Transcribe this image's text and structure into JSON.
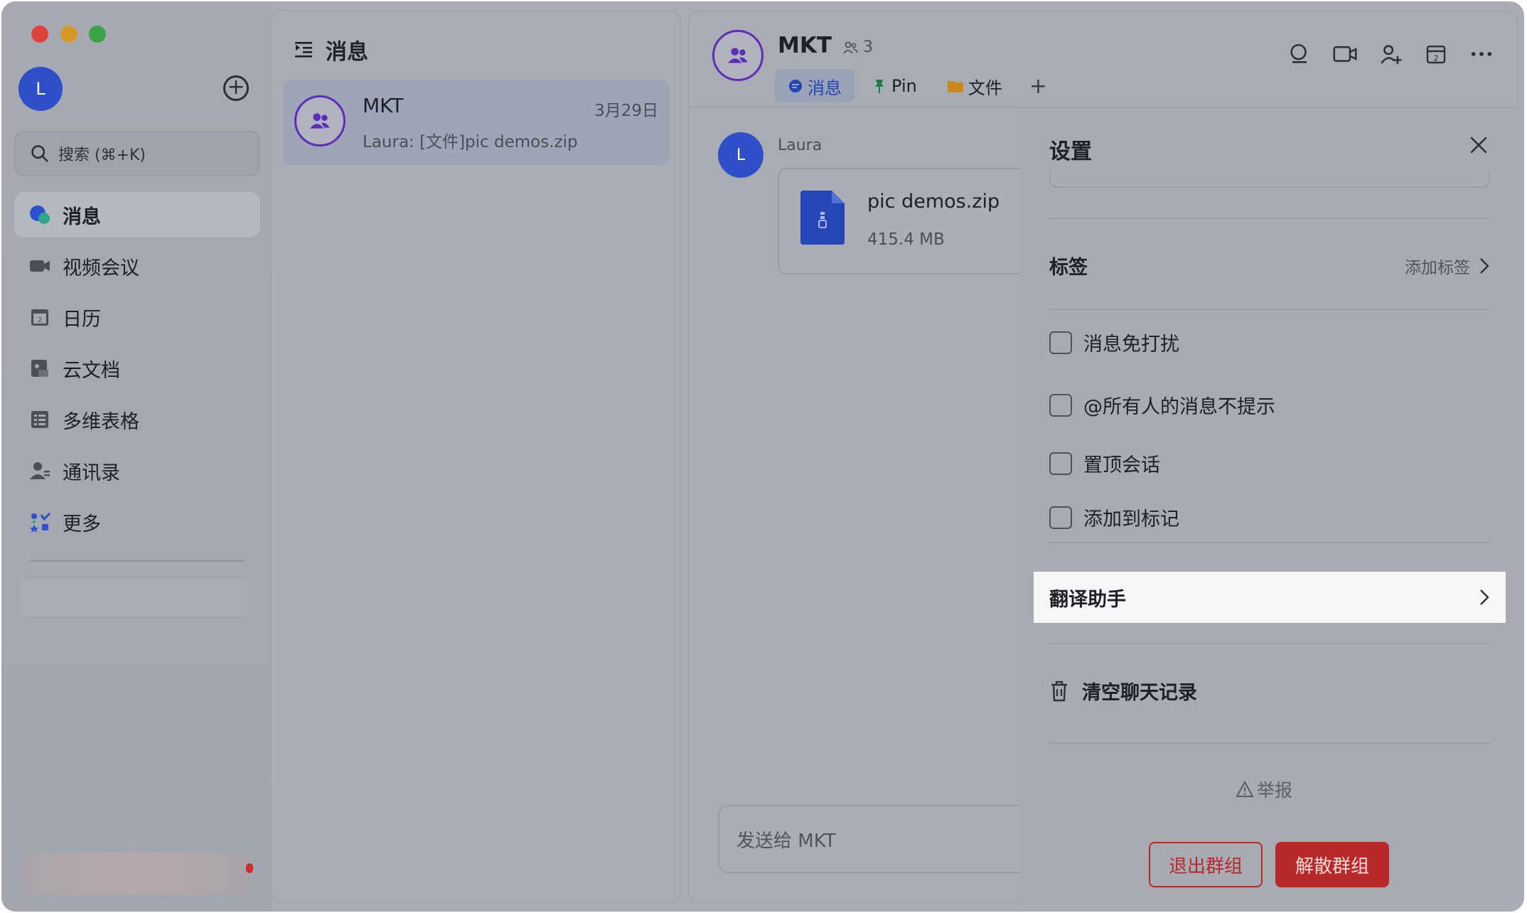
{
  "self_avatar_letter": "L",
  "search": {
    "placeholder": "搜索 (⌘+K)"
  },
  "nav": {
    "items": [
      {
        "label": "消息",
        "icon": "chat-bubble-icon",
        "active": true
      },
      {
        "label": "视频会议",
        "icon": "video-camera-icon"
      },
      {
        "label": "日历",
        "icon": "calendar-icon"
      },
      {
        "label": "云文档",
        "icon": "cloud-doc-icon"
      },
      {
        "label": "多维表格",
        "icon": "table-icon"
      },
      {
        "label": "通讯录",
        "icon": "contacts-icon"
      },
      {
        "label": "更多",
        "icon": "apps-grid-icon"
      }
    ]
  },
  "list": {
    "title": "消息",
    "chats": [
      {
        "name": "MKT",
        "time": "3月29日",
        "preview": "Laura: [文件]pic demos.zip"
      }
    ]
  },
  "chat": {
    "title": "MKT",
    "member_count": "3",
    "tabs": [
      {
        "label": "消息",
        "icon": "chat-bubble-icon",
        "active": true
      },
      {
        "label": "Pin",
        "icon": "pin-icon"
      },
      {
        "label": "文件",
        "icon": "folder-icon"
      }
    ],
    "message": {
      "sender_letter": "L",
      "sender": "Laura",
      "file_name": "pic demos.zip",
      "file_size": "415.4 MB"
    },
    "composer_placeholder": "发送给 MKT"
  },
  "settings": {
    "title": "设置",
    "tag_label": "标签",
    "tag_action": "添加标签",
    "options": [
      "消息免打扰",
      "@所有人的消息不提示",
      "置顶会话",
      "添加到标记"
    ],
    "translate_label": "翻译助手",
    "clear_label": "清空聊天记录",
    "report_label": "举报",
    "leave_label": "退出群组",
    "dissolve_label": "解散群组"
  },
  "colors": {
    "accent_blue": "#2446b7",
    "danger_red": "#b8292a",
    "group_ring": "#5b2db8"
  }
}
